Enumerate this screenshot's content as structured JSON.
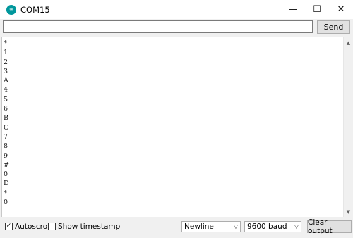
{
  "window": {
    "title": "COM15",
    "icon": "arduino-logo-icon",
    "controls": {
      "minimize": "—",
      "maximize": "☐",
      "close": "✕"
    }
  },
  "send": {
    "input_value": "",
    "button_label": "Send"
  },
  "output": {
    "lines": [
      "*",
      "1",
      "2",
      "3",
      "A",
      "4",
      "5",
      "6",
      "B",
      "C",
      "7",
      "8",
      "9",
      "#",
      "0",
      "D",
      "*",
      "0"
    ]
  },
  "footer": {
    "autoscroll": {
      "label": "Autoscroll",
      "checked": true
    },
    "show_timestamp": {
      "label": "Show timestamp",
      "checked": false
    },
    "line_ending": "Newline",
    "baud_rate": "9600 baud",
    "clear_label": "Clear output"
  },
  "colors": {
    "accent": "#00979c"
  }
}
